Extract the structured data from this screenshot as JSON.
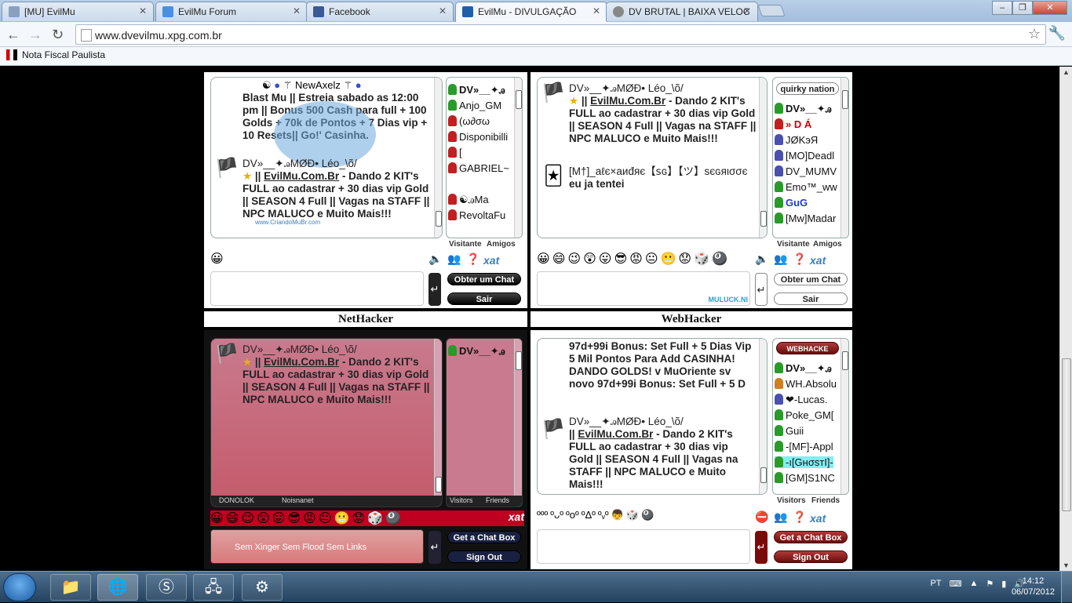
{
  "browser": {
    "tabs": [
      {
        "label": "[MU] EvilMu",
        "color": "#8aa0c0"
      },
      {
        "label": "EvilMu Forum",
        "color": "#4a90e2"
      },
      {
        "label": "Facebook",
        "color": "#3b5998"
      },
      {
        "label": "EvilMu - DIVULGAÇÃO",
        "color": "#1f5fa8",
        "active": true
      },
      {
        "label": "DV BRUTAL | BAIXA VELOC",
        "color": "#888"
      }
    ],
    "url": "www.dvevilmu.xpg.com.br",
    "bookmark": "Nota Fiscal Paulista"
  },
  "chat1": {
    "header": "NewAxelz",
    "msg1": "Blast Mu || Estreia sabado as 12:00 pm || Bonus 500 Cash para full + 100 Golds + 70k de Pontos + 7 Dias vip + 10 Resets|| Go!' Casinha.",
    "msg2_name": "DV»__✦ꭿMØÐ•     Léo_\\õ/",
    "msg2_link": "EvilMu.Com.Br",
    "msg2_text": " - Dando 2 KIT's FULL ao cadastrar + 30 dias vip Gold || SEASON 4 Full || Vagas na STAFF || NPC MALUCO e Muito Mais!!!",
    "watermark": "www.CriandoMuBr.com",
    "users": [
      "DV»__✦ꭿ",
      "Anjo_GM",
      "(ω∂σω",
      "Disponibilli",
      "[",
      "GABRIEL~",
      "☯ꭿMa",
      "RevoltaFu"
    ],
    "tab_visitors": "Visitante",
    "tab_friends": "Amigos",
    "btn_get": "Obter um Chat",
    "btn_exit": "Sair"
  },
  "chat2": {
    "msg1_name": "DV»__✦ꭿMØÐ•     Léo_\\õ/",
    "msg1_link": "EvilMu.Com.Br",
    "msg1_text": " - Dando 2 KIT's FULL ao cadastrar + 30 dias vip Gold || SEASON 4 Full || Vagas na STAFF || NPC MALUCO e Muito Mais!!!",
    "msg2_name": "[M†]_aℓє×aиđяє【ꜱɢ】【ツ】ѕєɢяισσє",
    "msg2_text": "eu ja tentei",
    "group": "quirky nation",
    "users": [
      "DV»__✦ꭿ",
      "» D Á",
      "JØKэЯ",
      "[MO]Deadl",
      "DV_MUMV",
      "Emo™_ww",
      "GuG",
      "[Mw]Madar"
    ],
    "footer": "MULUCK.NI",
    "tab_visitors": "Visitante",
    "tab_friends": "Amigos",
    "btn_get": "Obter um Chat",
    "btn_exit": "Sair"
  },
  "section_titles": {
    "left": "NetHacker",
    "right": "WebHacker"
  },
  "chat3": {
    "msg_name": "DV»__✦ꭿMØÐ•     Léo_\\õ/",
    "msg_link": "EvilMu.Com.Br",
    "msg_text": " - Dando 2 KIT's FULL ao cadastrar + 30 dias vip Gold || SEASON 4 Full || Vagas na STAFF || NPC MALUCO e Muito Mais!!!",
    "users": [
      "DV»__✦ꭿ"
    ],
    "tab1": "DONOLOK",
    "tab2": "Noisnanet",
    "tab_visitors": "Visitors",
    "tab_friends": "Friends",
    "input_placeholder": "Sem Xinger Sem Flood Sem Links",
    "btn_get": "Get a Chat Box",
    "btn_exit": "Sign Out"
  },
  "chat4": {
    "msg1": "97d+99i          Bonus: Set Full + 5 Dias Vip          5 Mil Pontos Para Add          CASINHA! DANDO GOLDS!          v MuOriente          sv novo 97d+99i     Bonus: Set Full + 5 D",
    "msg2_name": "DV»__✦ꭿMØÐ•     Léo_\\õ/",
    "msg2_link": "EvilMu.Com.Br",
    "msg2_text": " - Dando 2 KIT's FULL ao cadastrar + 30 dias vip Gold || SEASON 4 Full || Vagas na STAFF || NPC MALUCO e Muito Mais!!!",
    "group": "WEBHACKE",
    "users": [
      "DV»__✦ꭿ",
      "WH.Absolu",
      "❤-Lucas.",
      "Poke_GM[",
      "Guii",
      "-[MF]-Appl",
      "-ı[GнσsтI]-",
      "[GM]S1NC"
    ],
    "tab_visitors": "Visitors",
    "tab_friends": "Friends",
    "btn_get": "Get a Chat Box",
    "btn_exit": "Sign Out"
  },
  "taskbar": {
    "lang": "PT",
    "time": "14:12",
    "date": "06/07/2012"
  }
}
